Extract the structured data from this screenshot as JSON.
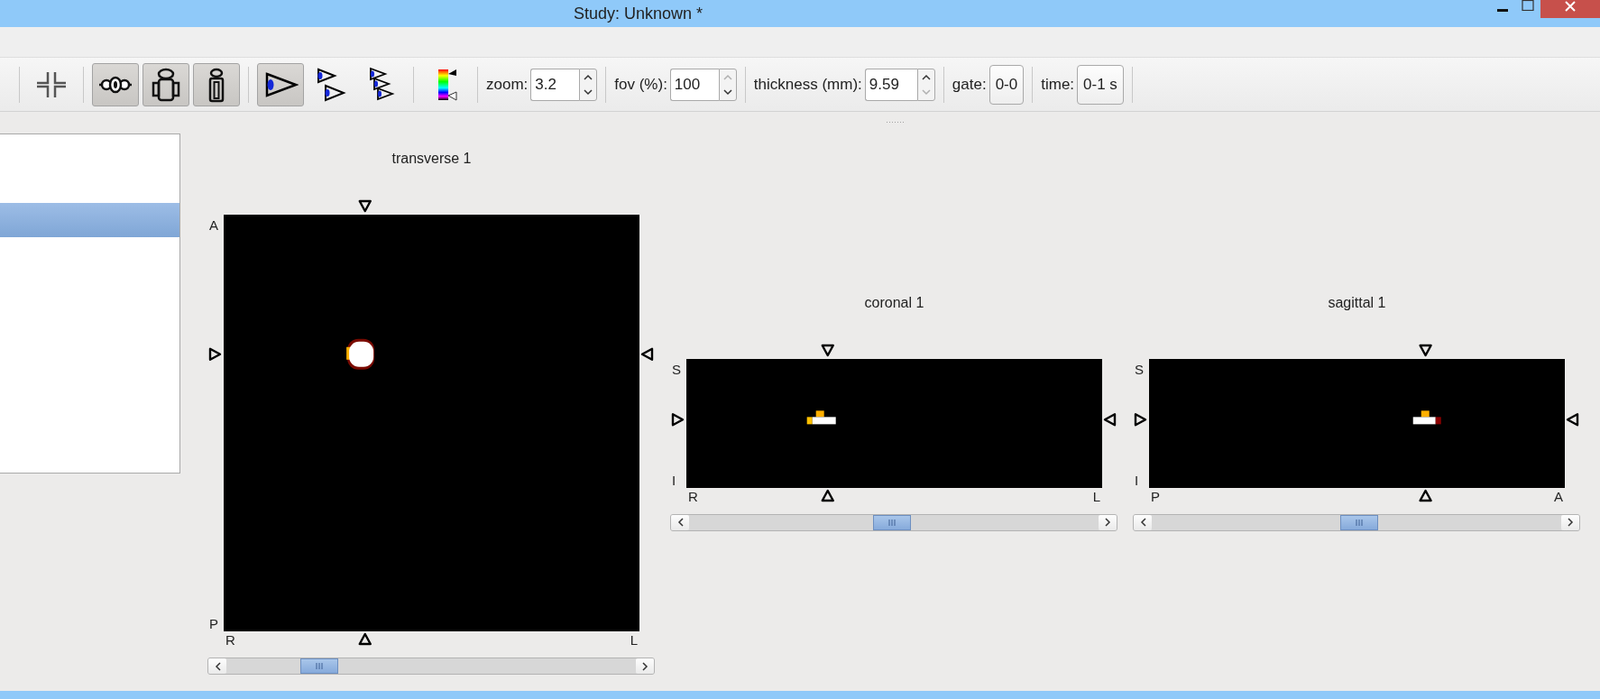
{
  "window": {
    "title": "Study: Unknown *"
  },
  "toolbar": {
    "groups": [
      {
        "tools": [
          {
            "kind": "crosshair",
            "pressed": false
          }
        ]
      },
      {
        "tools": [
          {
            "kind": "transverse",
            "pressed": true
          },
          {
            "kind": "coronal",
            "pressed": true
          },
          {
            "kind": "sagittal",
            "pressed": true
          }
        ]
      },
      {
        "tools": [
          {
            "kind": "single",
            "pressed": true
          },
          {
            "kind": "double",
            "pressed": false
          },
          {
            "kind": "triple",
            "pressed": false
          }
        ]
      },
      {
        "tools": [
          {
            "kind": "colorbar",
            "pressed": false
          }
        ]
      }
    ],
    "fields": [
      {
        "kind": "spin",
        "label": "zoom:",
        "value": "3.2",
        "up_disabled": false,
        "down_disabled": false
      },
      {
        "kind": "spin",
        "label": "fov (%):",
        "value": "100",
        "up_disabled": true,
        "down_disabled": false
      },
      {
        "kind": "spin",
        "label": "thickness (mm):",
        "value": "9.59",
        "up_disabled": false,
        "down_disabled": true
      },
      {
        "kind": "button",
        "label": "gate:",
        "value": "0-0"
      },
      {
        "kind": "button",
        "label": "time:",
        "value": "0-1 s"
      }
    ]
  },
  "list": {
    "rows": [
      {
        "selected": false
      },
      {
        "selected": false
      },
      {
        "selected": true
      }
    ]
  },
  "views": [
    {
      "kind": "transverse",
      "title": "transverse 1",
      "labels": {
        "top_left": "A",
        "bottom_left": "P",
        "under_left": "R",
        "under_right": "L"
      }
    },
    {
      "kind": "coronal",
      "title": "coronal 1",
      "labels": {
        "top_left": "S",
        "bottom_left": "I",
        "under_left": "R",
        "under_right": "L"
      }
    },
    {
      "kind": "sagittal",
      "title": "sagittal 1",
      "labels": {
        "top_left": "S",
        "bottom_left": "I",
        "under_left": "P",
        "under_right": "A"
      }
    }
  ]
}
